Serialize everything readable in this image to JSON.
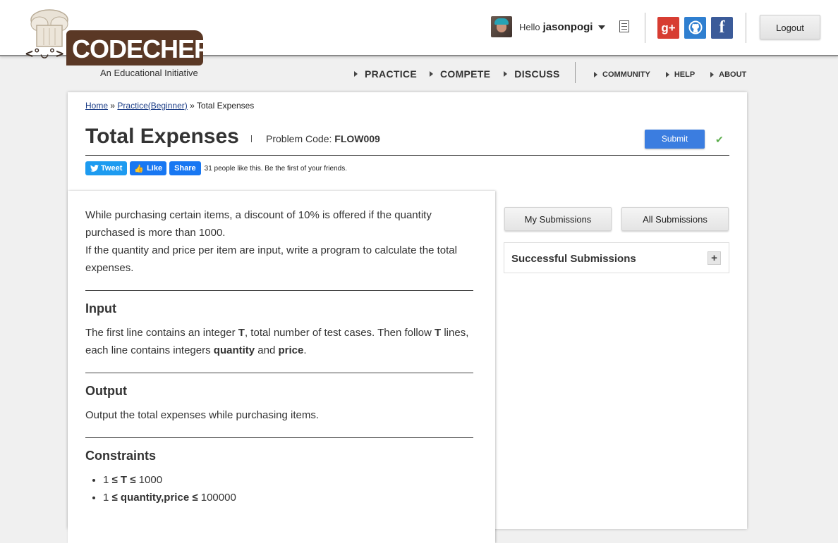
{
  "brand": {
    "logo_text": "CODECHEF",
    "tagline": "An Educational Initiative"
  },
  "user": {
    "greeting": "Hello",
    "username": "jasonpogi"
  },
  "header": {
    "logout_label": "Logout"
  },
  "social_icons": [
    "google-plus-icon",
    "github-icon",
    "facebook-icon"
  ],
  "nav": {
    "main": [
      "PRACTICE",
      "COMPETE",
      "DISCUSS"
    ],
    "secondary": [
      "COMMUNITY",
      "HELP",
      "ABOUT"
    ]
  },
  "breadcrumb": {
    "home": "Home",
    "section": "Practice(Beginner)",
    "separator": "»",
    "current": "Total Expenses"
  },
  "problem": {
    "title": "Total Expenses",
    "code_label": "Problem Code:",
    "code": "FLOW009",
    "submit_label": "Submit"
  },
  "share": {
    "tweet": "Tweet",
    "like": "Like",
    "share": "Share",
    "likes_text": "31 people like this. Be the first of your friends."
  },
  "statement": {
    "intro_1": "While purchasing certain items, a discount of 10% is offered if the quantity purchased is more than 1000.",
    "intro_2": "If the quantity and price per item are input, write a program to calculate the total expenses.",
    "input_heading": "Input",
    "input_text": {
      "a": "The first line contains an integer ",
      "t1": "T",
      "b": ", total number of test cases. Then follow ",
      "t2": "T",
      "c": " lines, each line contains integers ",
      "q": "quantity",
      "d": " and ",
      "p": "price",
      "e": "."
    },
    "output_heading": "Output",
    "output_text": "Output the total expenses while purchasing items.",
    "constraints_heading": "Constraints",
    "constraints": [
      {
        "lo": "1",
        "op1": "≤",
        "var": "T",
        "op2": "≤",
        "hi": "1000"
      },
      {
        "lo": "1",
        "op1": "≤",
        "var": "quantity,price",
        "op2": "≤",
        "hi": "100000"
      }
    ]
  },
  "sidebar": {
    "my_submissions": "My Submissions",
    "all_submissions": "All Submissions",
    "successful_submissions": "Successful Submissions",
    "expand_symbol": "+"
  },
  "colors": {
    "submit_blue": "#3b7de0",
    "check_green": "#5cae4c",
    "brand_brown": "#5a3825"
  }
}
